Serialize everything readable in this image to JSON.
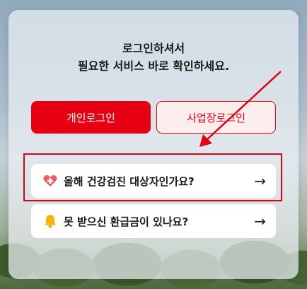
{
  "headline": {
    "line1": "로그인하셔서",
    "line2": "필요한 서비스 바로 확인하세요."
  },
  "login_buttons": {
    "personal": "개인로그인",
    "business": "사업장로그인"
  },
  "cards": [
    {
      "label": "올해 건강검진 대상자인가요?",
      "icon": "heart-plus-icon",
      "arrow": "→"
    },
    {
      "label": "못 받으신 환급금이 있나요?",
      "icon": "bell-icon",
      "arrow": "→"
    }
  ],
  "colors": {
    "brand_red": "#e60012",
    "annotation_red": "#e60012"
  }
}
